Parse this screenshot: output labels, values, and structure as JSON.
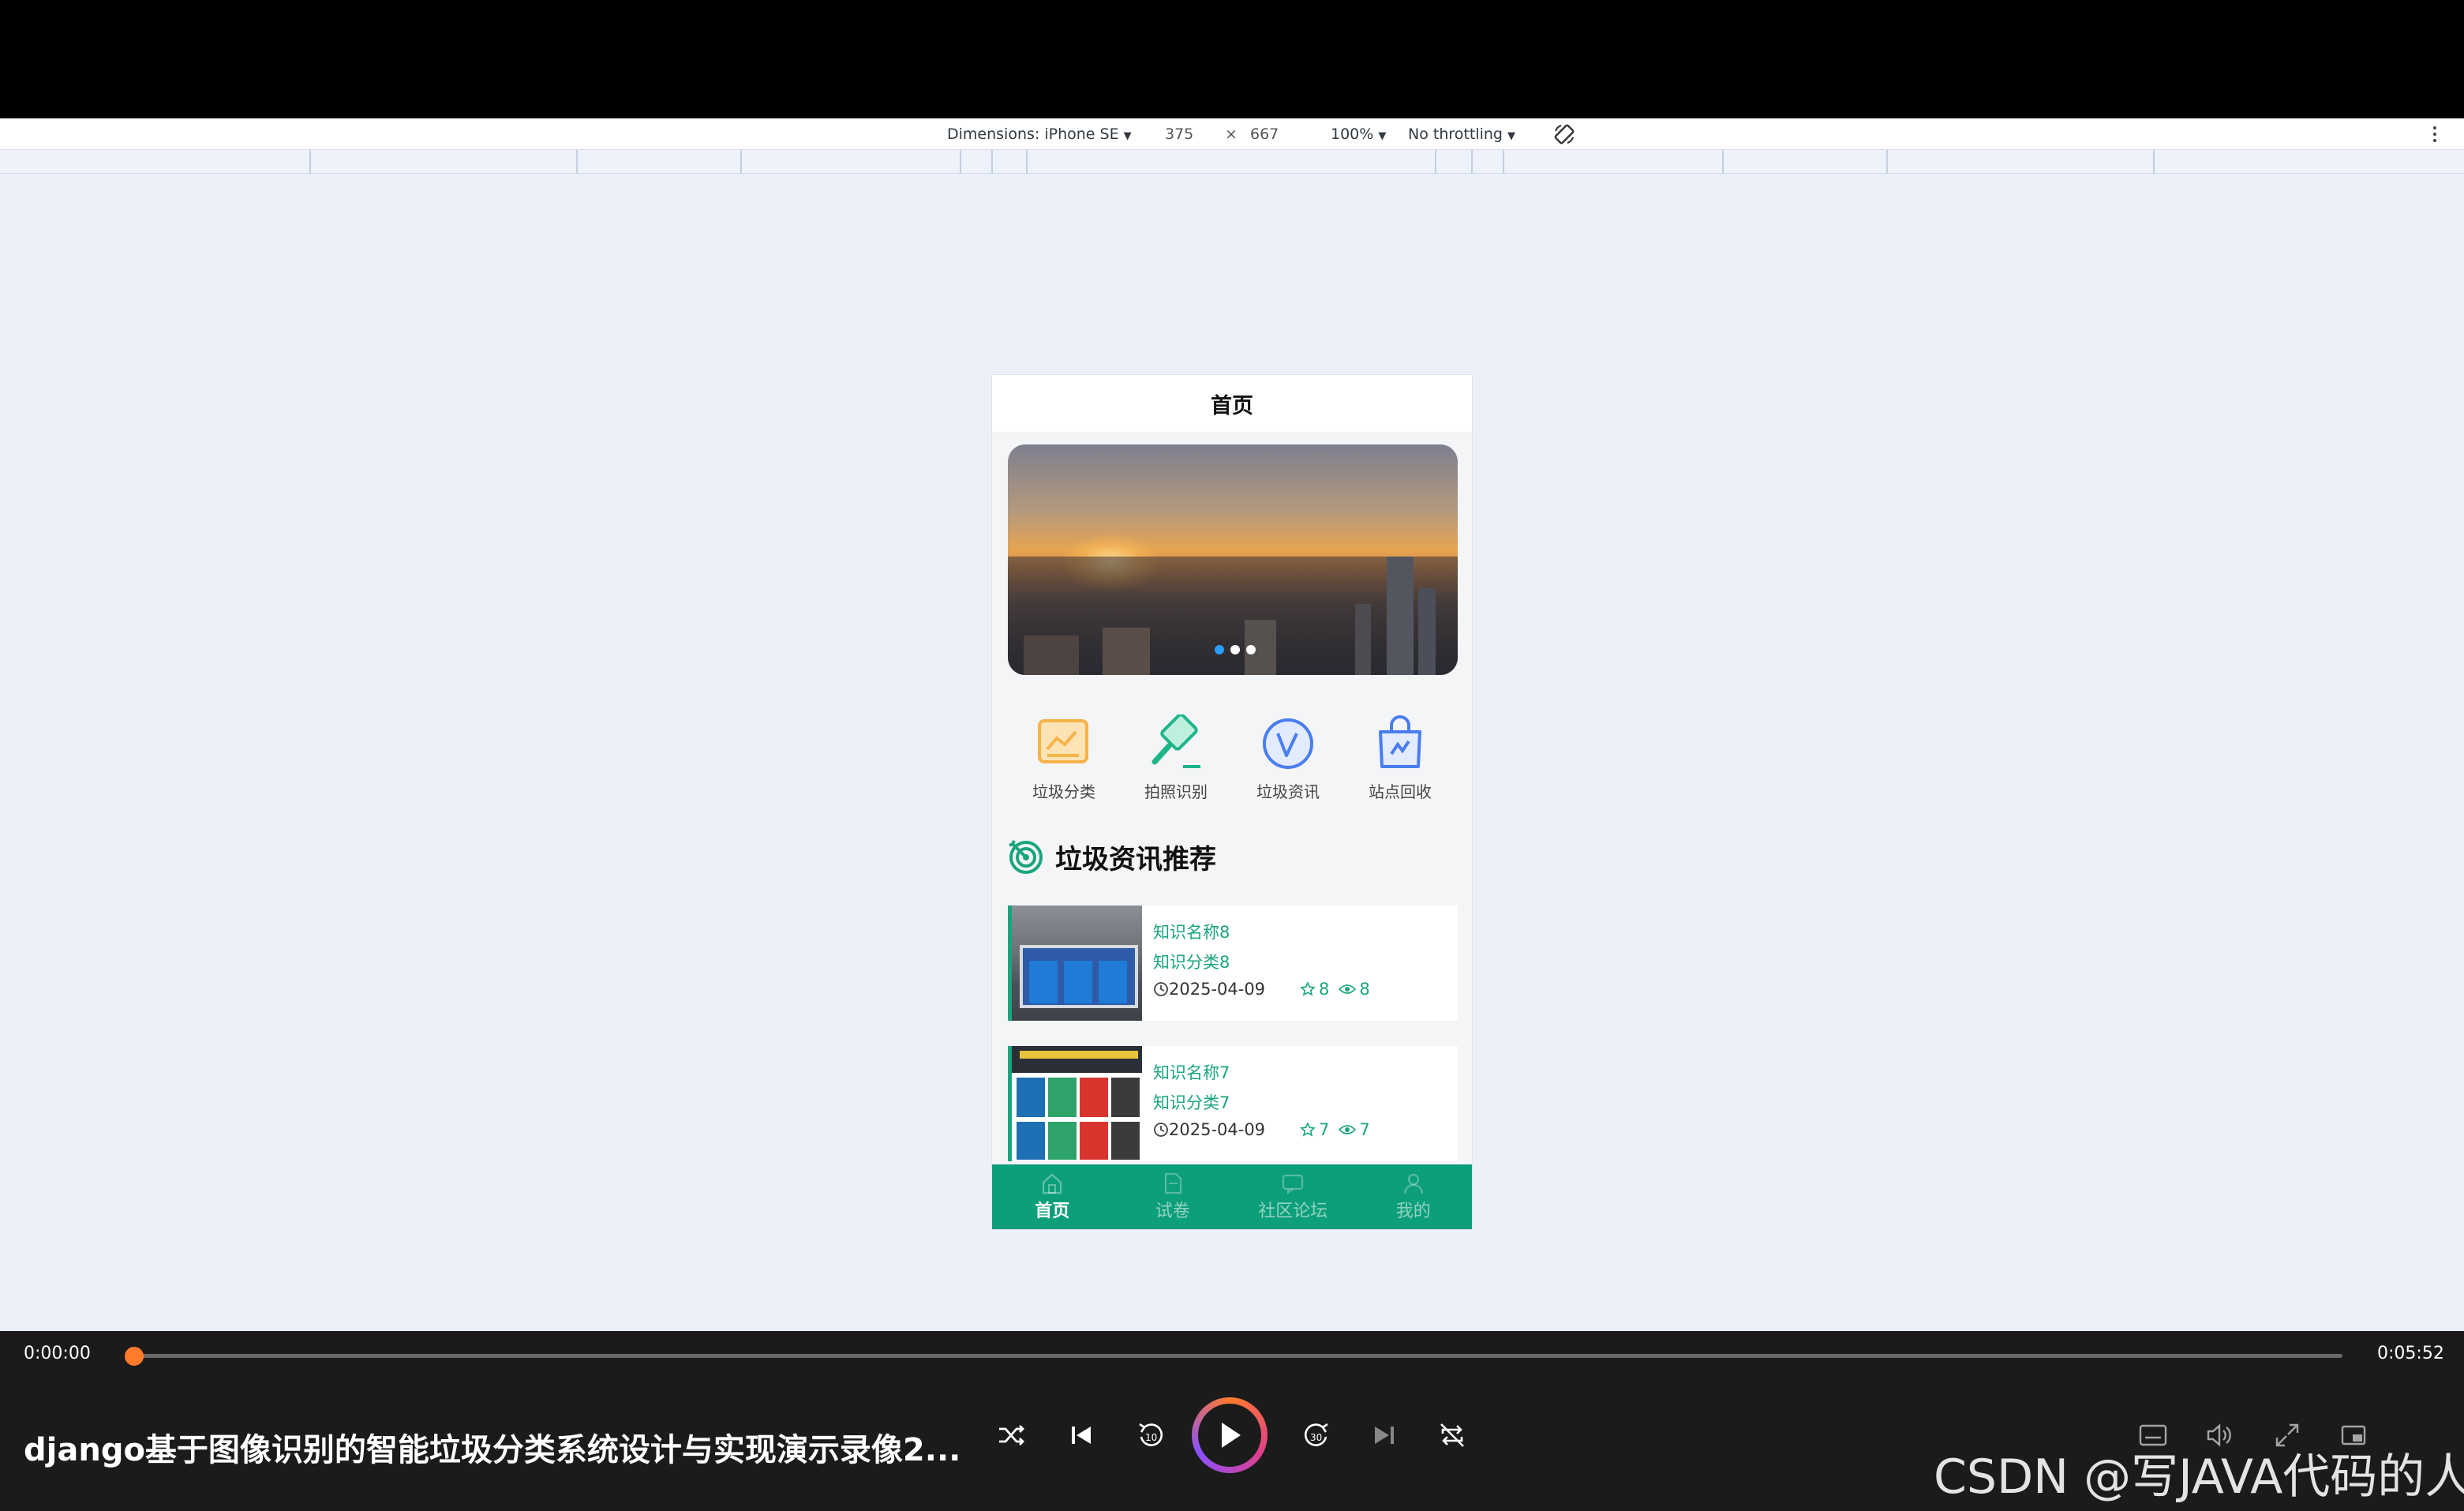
{
  "devtools": {
    "dimensions_label": "Dimensions: iPhone SE",
    "width": "375",
    "times": "×",
    "height": "667",
    "zoom": "100%",
    "throttling": "No throttling"
  },
  "app": {
    "nav_title": "首页",
    "banner_dots": 3,
    "banner_active_dot": 0,
    "shortcuts": [
      {
        "label": "垃圾分类",
        "icon": "chart-picture-icon",
        "color": "#f5b34a"
      },
      {
        "label": "拍照识别",
        "icon": "hammer-icon",
        "color": "#1fb58a"
      },
      {
        "label": "垃圾资讯",
        "icon": "v-circle-icon",
        "color": "#4a7df0"
      },
      {
        "label": "站点回收",
        "icon": "bag-icon",
        "color": "#4a7df0"
      }
    ],
    "section_title": "垃圾资讯推荐",
    "news": [
      {
        "name": "知识名称8",
        "category": "知识分类8",
        "date": "2025-04-09",
        "likes": "8",
        "views": "8"
      },
      {
        "name": "知识名称7",
        "category": "知识分类7",
        "date": "2025-04-09",
        "likes": "7",
        "views": "7"
      }
    ],
    "tabs": [
      {
        "label": "首页",
        "active": true
      },
      {
        "label": "试卷",
        "active": false
      },
      {
        "label": "社区论坛",
        "active": false
      },
      {
        "label": "我的",
        "active": false
      }
    ],
    "accent_color": "#0d9e7a"
  },
  "player": {
    "current_time": "0:00:00",
    "total_time": "0:05:52",
    "progress": 0,
    "title": "django基于图像识别的智能垃圾分类系统设计与实现演示录像2...",
    "watermark": "CSDN @写JAVA代码的人"
  }
}
